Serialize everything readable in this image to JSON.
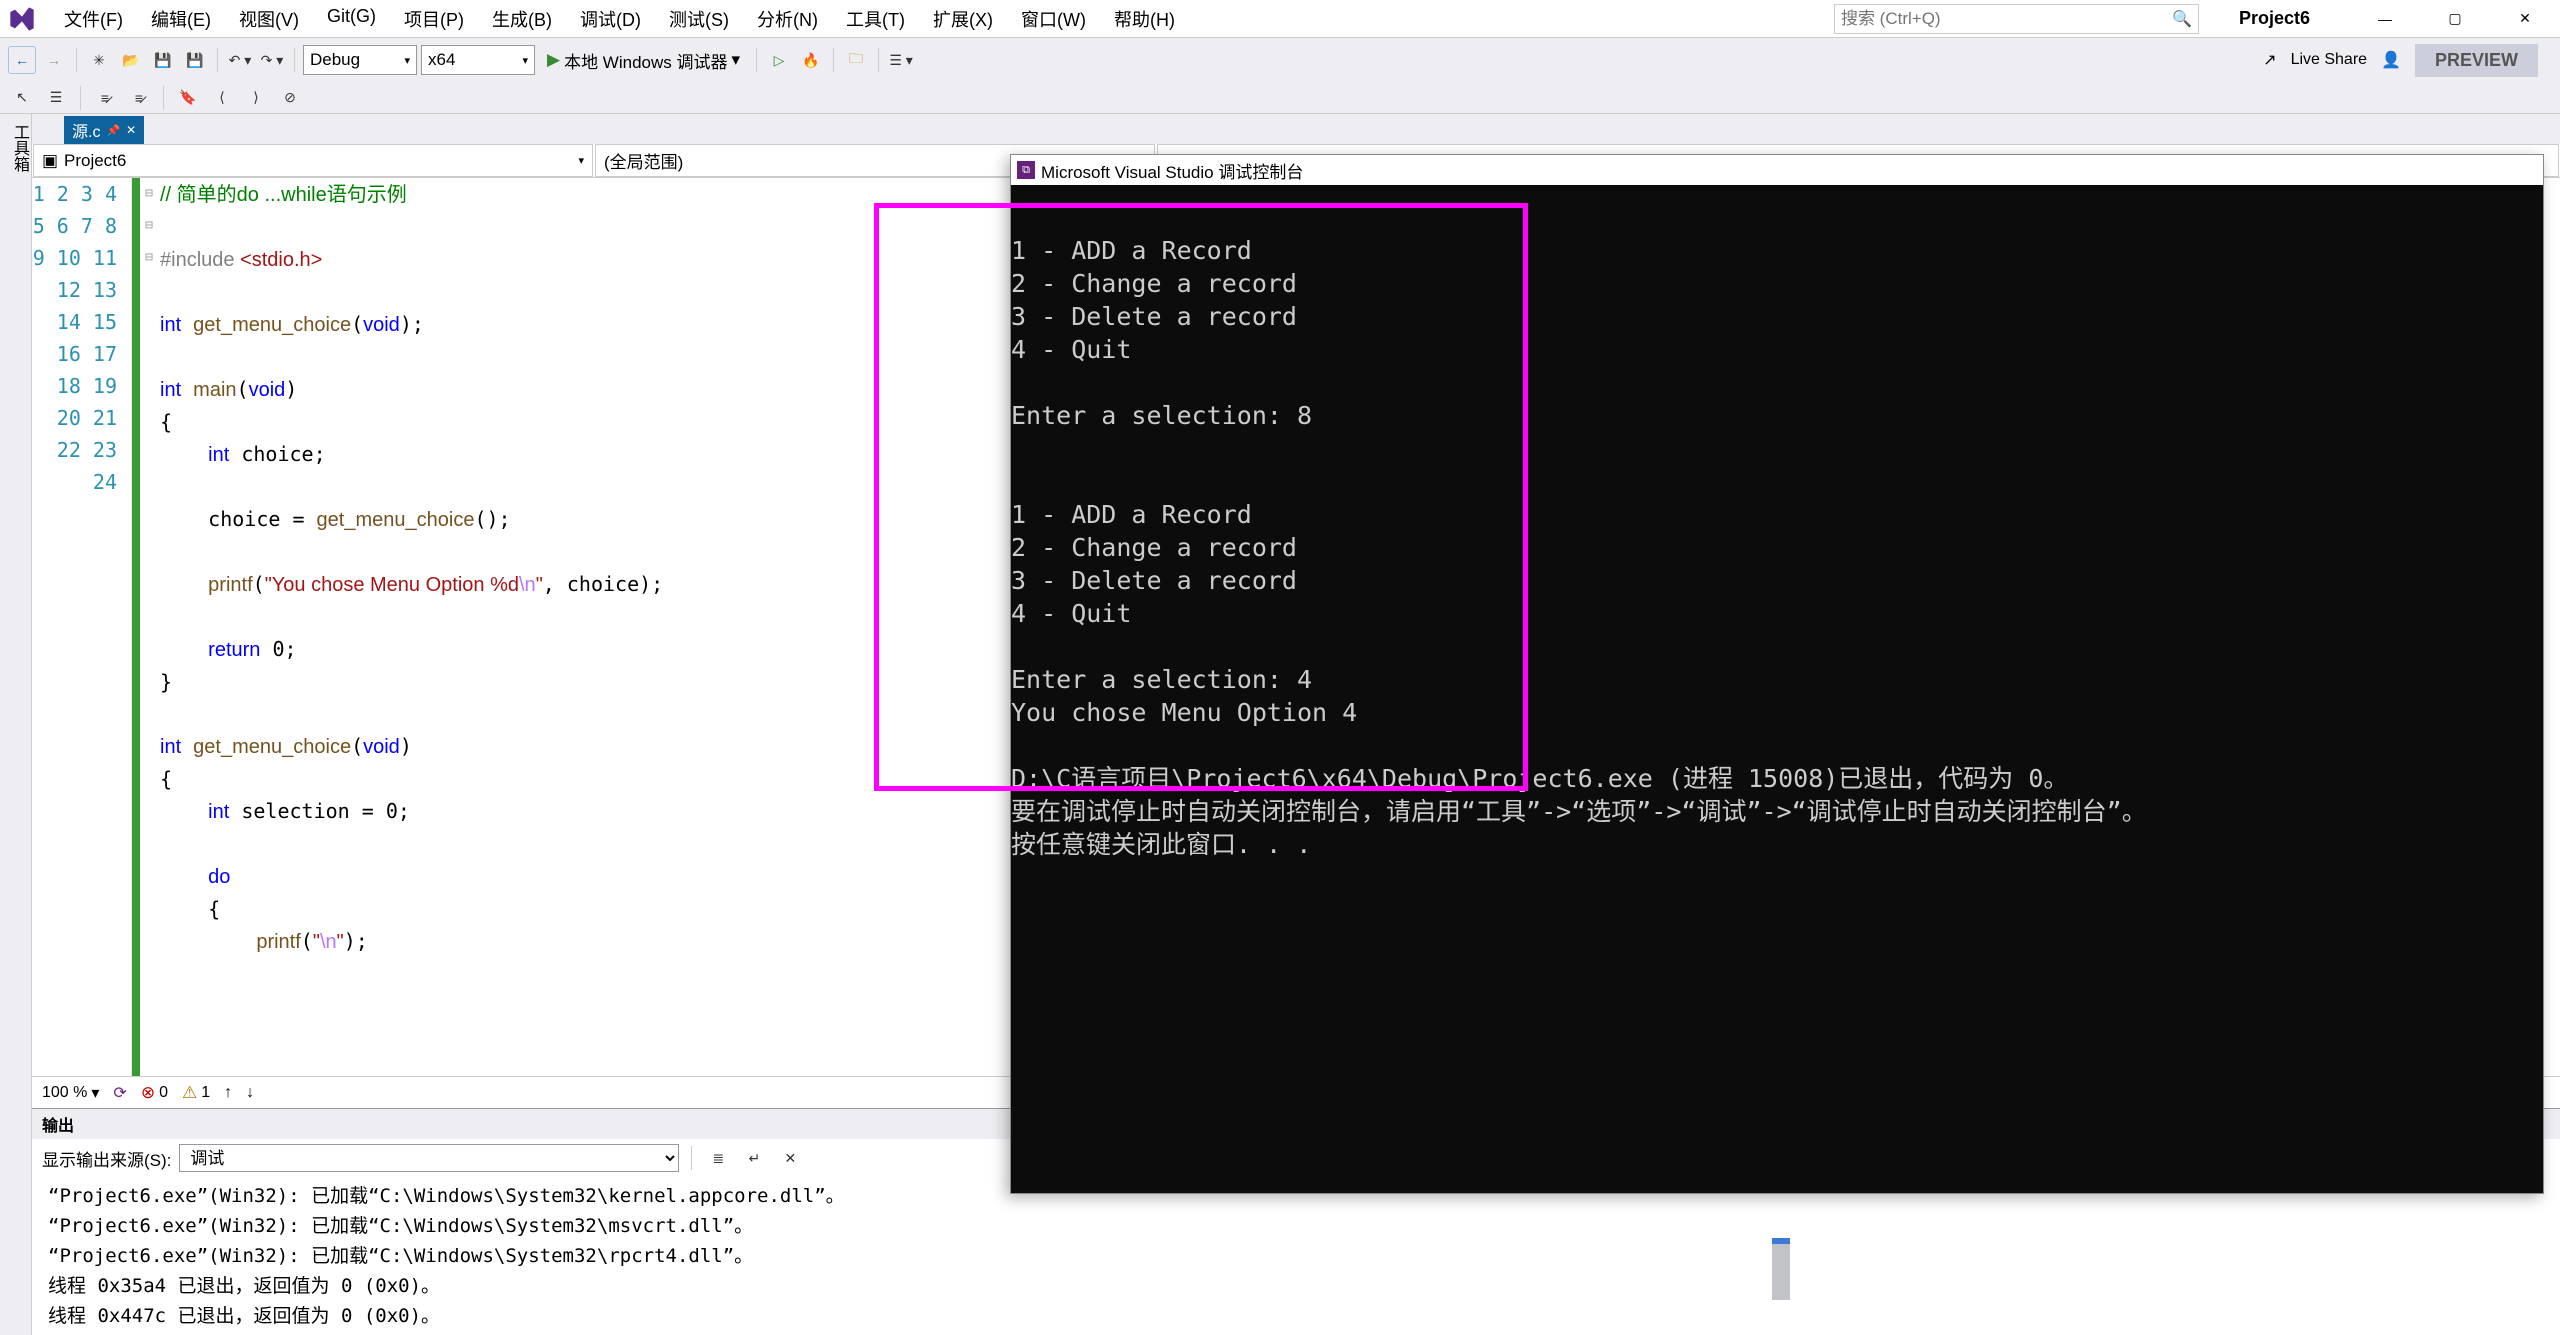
{
  "menubar": {
    "items": [
      "文件(F)",
      "编辑(E)",
      "视图(V)",
      "Git(G)",
      "项目(P)",
      "生成(B)",
      "调试(D)",
      "测试(S)",
      "分析(N)",
      "工具(T)",
      "扩展(X)",
      "窗口(W)",
      "帮助(H)"
    ],
    "search_placeholder": "搜索 (Ctrl+Q)",
    "project_title": "Project6"
  },
  "toolbar": {
    "config": "Debug",
    "platform": "x64",
    "run_label": "本地 Windows 调试器",
    "live_share": "Live Share",
    "preview": "PREVIEW"
  },
  "sidebar_vertical": "工具箱",
  "tab": {
    "name": "源.c"
  },
  "nav": {
    "project": "Project6",
    "scope": "(全局范围)"
  },
  "code": {
    "lines": [
      {
        "n": 1,
        "t": "// 简单的do ...while语句示例",
        "cls": "comment"
      },
      {
        "n": 2,
        "t": ""
      },
      {
        "n": 3,
        "html": "<span class='prep'>#include </span><span class='str'>&lt;stdio.h&gt;</span>"
      },
      {
        "n": 4,
        "t": ""
      },
      {
        "n": 5,
        "html": "<span class='kw'>int</span> <span class='fn'>get_menu_choice</span>(<span class='kw'>void</span>);"
      },
      {
        "n": 6,
        "t": ""
      },
      {
        "n": 7,
        "fold": "⊟",
        "html": "<span class='kw'>int</span> <span class='fn'>main</span>(<span class='kw'>void</span>)"
      },
      {
        "n": 8,
        "t": "{"
      },
      {
        "n": 9,
        "html": "    <span class='kw'>int</span> choice;"
      },
      {
        "n": 10,
        "t": ""
      },
      {
        "n": 11,
        "html": "    choice = <span class='fn'>get_menu_choice</span>();"
      },
      {
        "n": 12,
        "t": ""
      },
      {
        "n": 13,
        "html": "    <span class='fn'>printf</span>(<span class='str'>\"You chose Menu Option %d</span><span class='esc'>\\n</span><span class='str'>\"</span>, choice);"
      },
      {
        "n": 14,
        "t": ""
      },
      {
        "n": 15,
        "html": "    <span class='kw'>return</span> 0;"
      },
      {
        "n": 16,
        "t": "}"
      },
      {
        "n": 17,
        "t": ""
      },
      {
        "n": 18,
        "fold": "⊟",
        "html": "<span class='kw'>int</span> <span class='fn'>get_menu_choice</span>(<span class='kw'>void</span>)"
      },
      {
        "n": 19,
        "t": "{"
      },
      {
        "n": 20,
        "html": "    <span class='kw'>int</span> selection = 0;"
      },
      {
        "n": 21,
        "t": ""
      },
      {
        "n": 22,
        "fold": "⊟",
        "html": "    <span class='kw'>do</span>"
      },
      {
        "n": 23,
        "t": "    {"
      },
      {
        "n": 24,
        "html": "        <span class='fn'>printf</span>(<span class='str'>\"</span><span class='esc'>\\n</span><span class='str'>\"</span>);"
      }
    ]
  },
  "status": {
    "zoom": "100 %",
    "errors": "0",
    "warnings": "1"
  },
  "output": {
    "title": "输出",
    "src_label": "显示输出来源(S):",
    "src_value": "调试",
    "lines": [
      "“Project6.exe”(Win32): 已加载“C:\\Windows\\System32\\kernel.appcore.dll”。",
      "“Project6.exe”(Win32): 已加载“C:\\Windows\\System32\\msvcrt.dll”。",
      "“Project6.exe”(Win32): 已加载“C:\\Windows\\System32\\rpcrt4.dll”。",
      "线程 0x35a4 已退出，返回值为 0 (0x0)。",
      "线程 0x447c 已退出，返回值为 0 (0x0)。"
    ]
  },
  "console": {
    "title": "Microsoft Visual Studio 调试控制台",
    "body": "\n1 - ADD a Record\n2 - Change a record\n3 - Delete a record\n4 - Quit\n\nEnter a selection: 8\n\n\n1 - ADD a Record\n2 - Change a record\n3 - Delete a record\n4 - Quit\n\nEnter a selection: 4\nYou chose Menu Option 4\n\nD:\\C语言项目\\Project6\\x64\\Debug\\Project6.exe (进程 15008)已退出，代码为 0。\n要在调试停止时自动关闭控制台，请启用“工具”->“选项”->“调试”->“调试停止时自动关闭控制台”。\n按任意键关闭此窗口. . ."
  }
}
